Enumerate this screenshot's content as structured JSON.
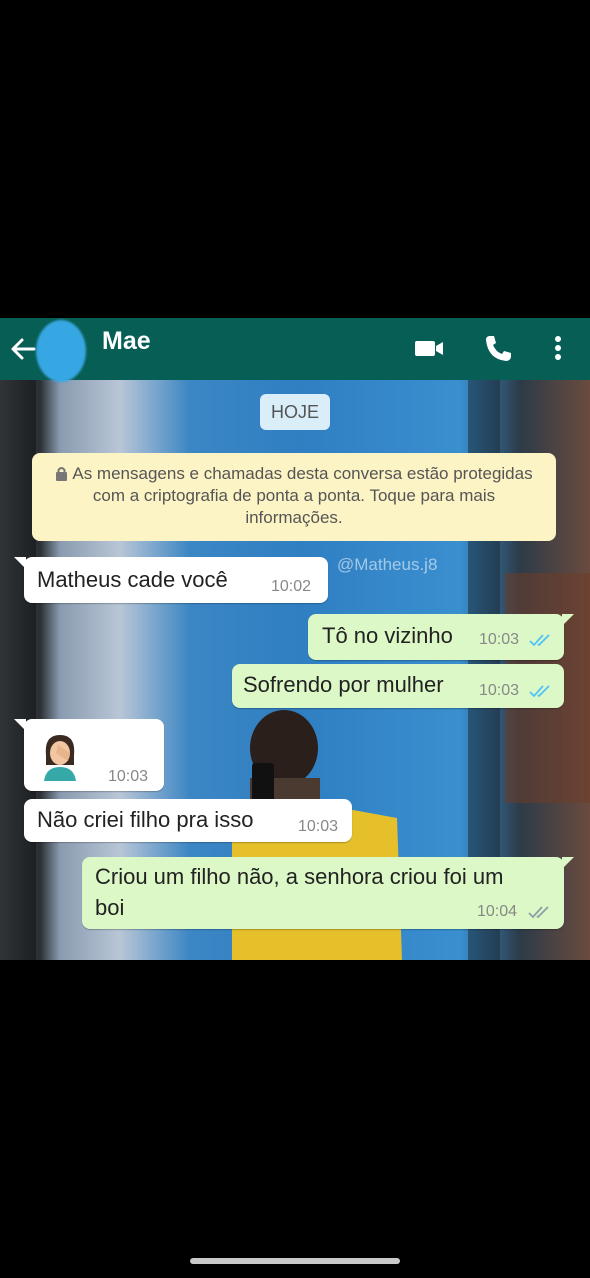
{
  "header": {
    "contact_name": "Mae",
    "icons": [
      "back-arrow-icon",
      "video-call-icon",
      "phone-icon",
      "more-vert-icon"
    ],
    "colors": {
      "bar": "#075e54",
      "avatar_blur": "#37a7e3"
    }
  },
  "chat": {
    "date_label": "HOJE",
    "encryption_notice": "As mensagens e chamadas desta conversa estão protegidas com a criptografia de ponta a ponta. Toque para mais informações.",
    "watermark": "@Matheus.j8",
    "messages": [
      {
        "direction": "incoming",
        "text": "Matheus cade você",
        "time": "10:02"
      },
      {
        "direction": "outgoing",
        "text": "Tô no vizinho",
        "time": "10:03",
        "status": "read"
      },
      {
        "direction": "outgoing",
        "text": "Sofrendo por mulher",
        "time": "10:03",
        "status": "read"
      },
      {
        "direction": "incoming",
        "emoji": "woman-facepalming",
        "time": "10:03"
      },
      {
        "direction": "incoming",
        "text": "Não criei filho pra isso",
        "time": "10:03"
      },
      {
        "direction": "outgoing",
        "text_line1": "Criou um filho não, a senhora criou foi um",
        "text_line2": "boi",
        "time": "10:04",
        "status": "read"
      }
    ],
    "colors": {
      "incoming": "#ffffff",
      "outgoing": "#dcf8c6",
      "notice": "#fcf4c5",
      "date_pill": "#d9eef8",
      "read_ticks": "#4fc3f7"
    }
  }
}
